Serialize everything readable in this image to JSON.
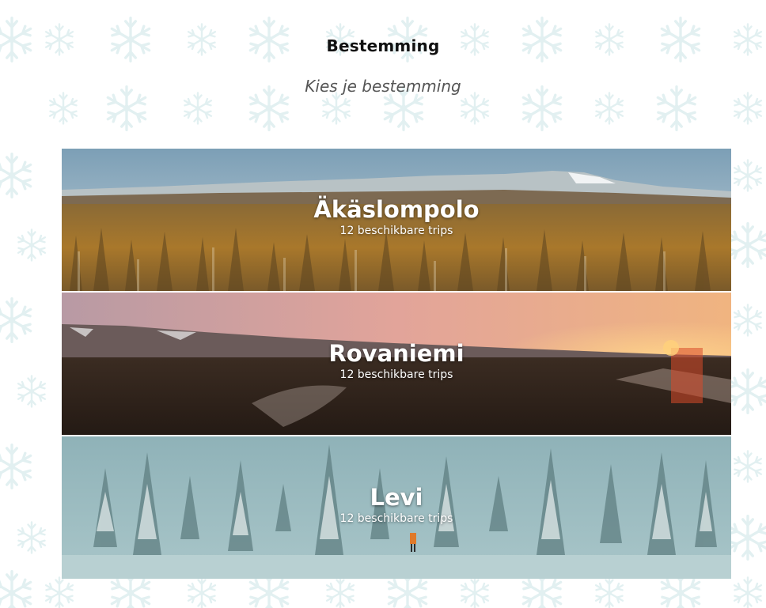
{
  "header": {
    "title": "Bestemming",
    "subtitle": "Kies je bestemming"
  },
  "destinations": [
    {
      "name": "Äkäslompolo",
      "trips": "12 beschikbare trips",
      "scene": "autumn-forest-fell"
    },
    {
      "name": "Rovaniemi",
      "trips": "12 beschikbare trips",
      "scene": "sunset-forest-fells"
    },
    {
      "name": "Levi",
      "trips": "12 beschikbare trips",
      "scene": "snowy-forest-skier"
    }
  ],
  "colors": {
    "background": "#ffffff",
    "snowflake": "#e3f1f2",
    "title": "#111111",
    "subtitle": "#555555",
    "card_text": "#ffffff"
  },
  "icons": {
    "background_pattern": "snowflake-icon"
  }
}
